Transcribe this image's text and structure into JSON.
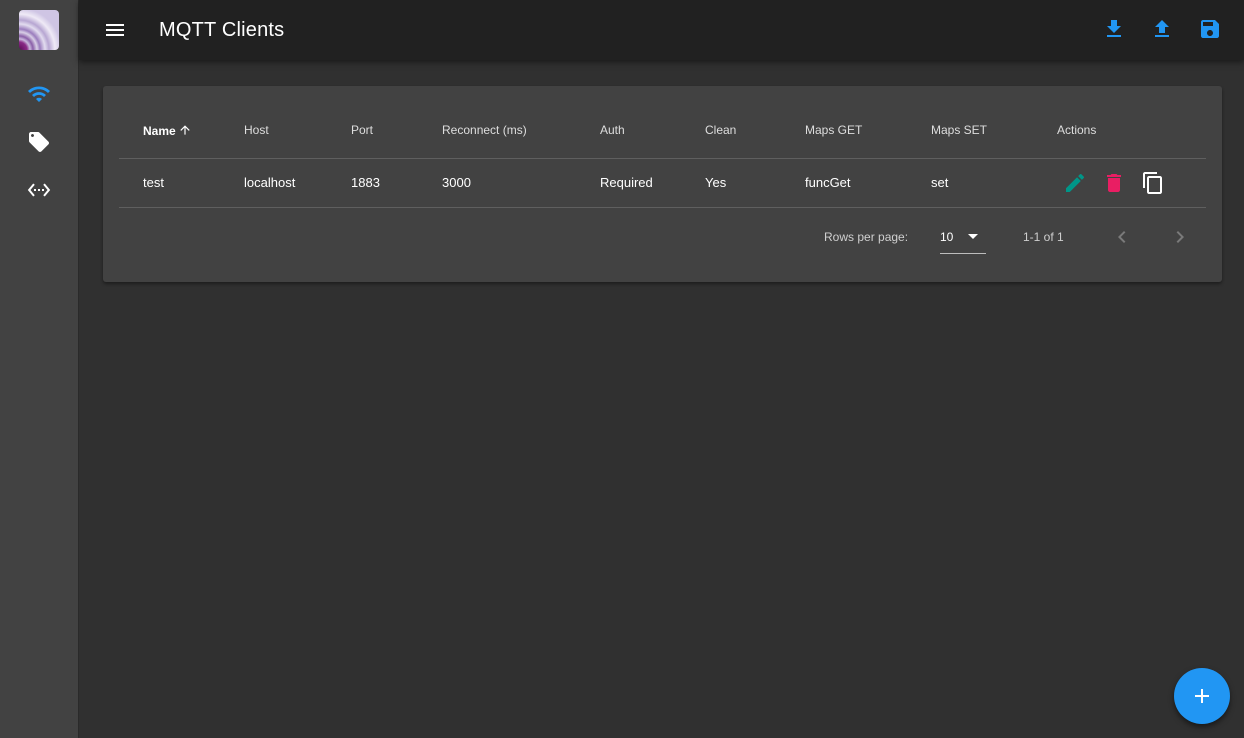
{
  "app": {
    "title": "MQTT Clients"
  },
  "colors": {
    "accent": "#2196f3",
    "edit": "#009688",
    "delete": "#e91e63",
    "background": "#303030",
    "surface": "#424242",
    "appbar": "#212121"
  },
  "sidebar": {
    "items": [
      {
        "icon": "wifi-icon",
        "active": true
      },
      {
        "icon": "tag-icon",
        "active": false
      },
      {
        "icon": "settings-ethernet-icon",
        "active": false
      }
    ]
  },
  "toolbar": {
    "actions": [
      "download-icon",
      "upload-icon",
      "save-icon"
    ]
  },
  "table": {
    "columns": [
      "Name",
      "Host",
      "Port",
      "Reconnect (ms)",
      "Auth",
      "Clean",
      "Maps GET",
      "Maps SET",
      "Actions"
    ],
    "sorted_column": "Name",
    "sort_direction": "ascending",
    "rows": [
      [
        "test",
        "localhost",
        "1883",
        "3000",
        "Required",
        "Yes",
        "funcGet",
        "set"
      ]
    ],
    "row_actions": [
      "edit-icon",
      "delete-icon",
      "copy-icon"
    ]
  },
  "pagination": {
    "rows_per_page_label": "Rows per page:",
    "rows_per_page": "10",
    "range": "1-1 of 1"
  },
  "fab": {
    "icon": "add-icon"
  }
}
